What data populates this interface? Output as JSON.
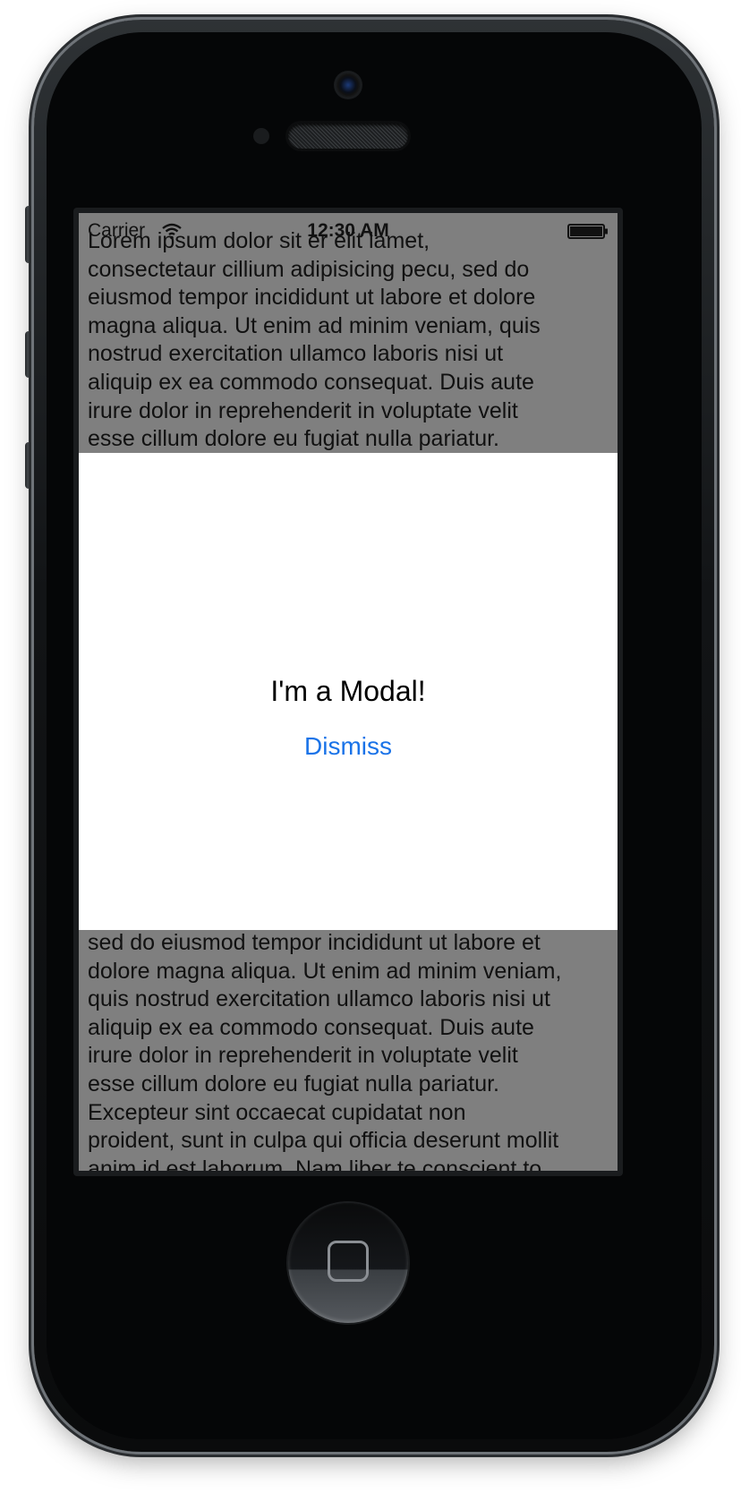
{
  "status_bar": {
    "carrier": "Carrier",
    "time": "12:30 AM"
  },
  "background_text": {
    "top_lines": [
      "Lorem ipsum dolor sit er elit lamet,",
      "consectetaur cillium adipisicing pecu, sed do",
      "eiusmod tempor incididunt ut labore et dolore",
      "magna aliqua. Ut enim ad minim veniam, quis",
      "nostrud exercitation ullamco laboris nisi ut",
      "aliquip ex ea commodo consequat. Duis aute",
      "irure dolor in reprehenderit in voluptate velit",
      "esse cillum dolore eu fugiat nulla pariatur."
    ],
    "bottom_lines": [
      "sed do eiusmod tempor incididunt ut labore et",
      "dolore magna aliqua. Ut enim ad minim veniam,",
      "quis nostrud exercitation ullamco laboris nisi ut",
      "aliquip ex ea commodo consequat. Duis aute",
      "irure dolor in reprehenderit in voluptate velit",
      "esse cillum dolore eu fugiat nulla pariatur.",
      "Excepteur sint occaecat cupidatat non",
      "proident, sunt in culpa qui officia deserunt mollit",
      "anim id est laborum. Nam liber te conscient to"
    ]
  },
  "modal": {
    "title": "I'm a Modal!",
    "dismiss_label": "Dismiss"
  },
  "colors": {
    "overlay_background": "#7f7f7f",
    "modal_background": "#ffffff",
    "link_blue": "#1a73e8"
  },
  "icons": {
    "wifi": "wifi-icon",
    "battery": "battery-icon",
    "home": "home-button-icon"
  }
}
